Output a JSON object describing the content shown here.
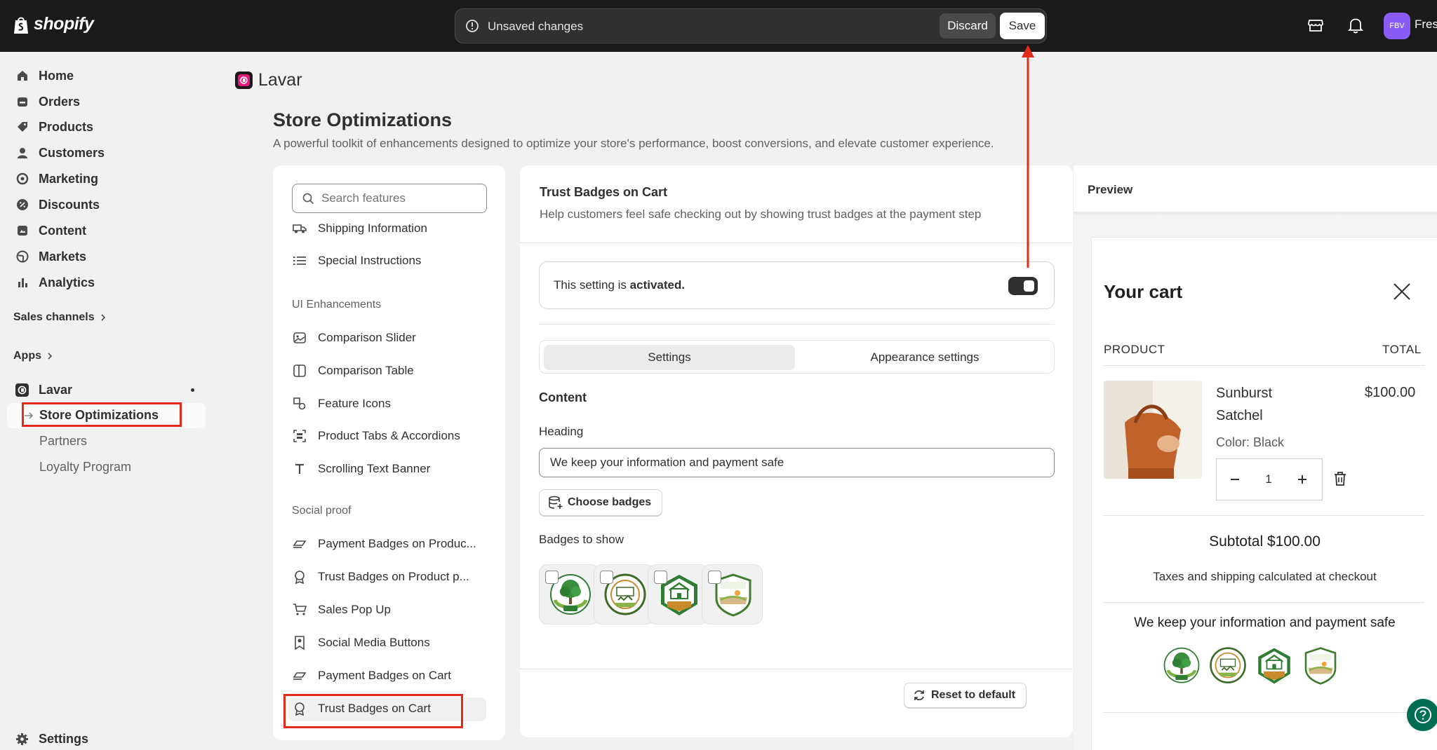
{
  "topbar": {
    "logo_text": "shopify",
    "unsaved_text": "Unsaved changes",
    "discard_label": "Discard",
    "save_label": "Save",
    "avatar_initials": "FBV",
    "store_name": "Fres"
  },
  "sidebar": {
    "items": [
      {
        "label": "Home",
        "icon": "home-icon"
      },
      {
        "label": "Orders",
        "icon": "orders-icon"
      },
      {
        "label": "Products",
        "icon": "tag-icon"
      },
      {
        "label": "Customers",
        "icon": "person-icon"
      },
      {
        "label": "Marketing",
        "icon": "target-icon"
      },
      {
        "label": "Discounts",
        "icon": "discount-icon"
      },
      {
        "label": "Content",
        "icon": "content-icon"
      },
      {
        "label": "Markets",
        "icon": "globe-icon"
      },
      {
        "label": "Analytics",
        "icon": "bar-chart-icon"
      }
    ],
    "sales_channels": "Sales channels",
    "apps": "Apps",
    "app_name": "Lavar",
    "sub_items": [
      "Store Optimizations",
      "Partners",
      "Loyalty Program"
    ],
    "settings": "Settings"
  },
  "page": {
    "app_title": "Lavar",
    "title": "Store Optimizations",
    "description": "A powerful toolkit of enhancements designed to optimize your store's performance, boost conversions, and elevate customer experience."
  },
  "features": {
    "search_placeholder": "Search features",
    "top_items": [
      "Shipping Information",
      "Special Instructions"
    ],
    "sections": [
      {
        "title": "UI Enhancements",
        "items": [
          "Comparison Slider",
          "Comparison Table",
          "Feature Icons",
          "Product Tabs & Accordions",
          "Scrolling Text Banner"
        ]
      },
      {
        "title": "Social proof",
        "items": [
          "Payment Badges on Produc...",
          "Trust Badges on Product p...",
          "Sales Pop Up",
          "Social Media Buttons",
          "Payment Badges on Cart",
          "Trust Badges on Cart"
        ]
      }
    ]
  },
  "settings": {
    "title": "Trust Badges on Cart",
    "description": "Help customers feel safe checking out by showing trust badges at the payment step",
    "activation_prefix": "This setting is ",
    "activation_state": "activated.",
    "toggle_on": true,
    "tabs": [
      "Settings",
      "Appearance settings"
    ],
    "content_heading": "Content",
    "heading_label": "Heading",
    "heading_value": "We keep your information and payment safe",
    "choose_badges": "Choose badges",
    "badges_label": "Badges to show",
    "badges": [
      "eco-tree-badge",
      "natural-products-eco-food-badge",
      "bio-products-badge",
      "natural-products-badge"
    ],
    "reset_label": "Reset to default"
  },
  "preview": {
    "label": "Preview",
    "cart_title": "Your cart",
    "col_product": "PRODUCT",
    "col_total": "TOTAL",
    "product_name": "Sunburst Satchel",
    "product_price": "$100.00",
    "product_color": "Color: Black",
    "quantity": "1",
    "subtotal": "Subtotal $100.00",
    "tax_note": "Taxes and shipping calculated at checkout",
    "safe_heading": "We keep your information and payment safe"
  },
  "colors": {
    "topbar": "#1a1a1a",
    "highlight": "#e32b1b",
    "help_button": "#006e52"
  }
}
